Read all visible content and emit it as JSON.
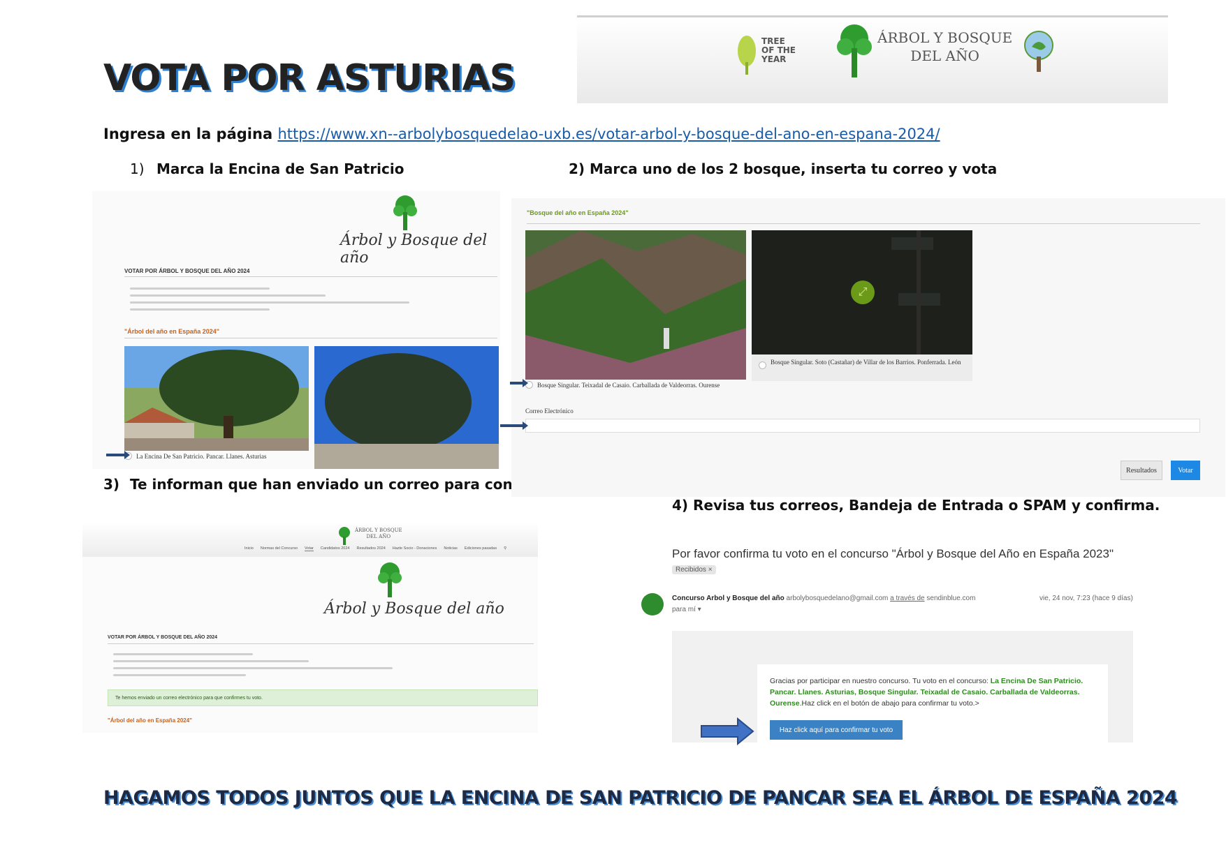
{
  "title": "VOTA POR ASTURIAS",
  "banner": {
    "tree_of_year": [
      "TREE",
      "OF THE",
      "YEAR"
    ],
    "arbol_line1": "ÁRBOL Y BOSQUE",
    "arbol_line2": "DEL AÑO"
  },
  "intro": {
    "text": "Ingresa en la página",
    "url": "https://www.xn--arbolybosquedelao-uxb.es/votar-arbol-y-bosque-del-ano-en-espana-2024/"
  },
  "steps": {
    "s1_num": "1)",
    "s1": "Marca la Encina de San Patricio",
    "s2": "2) Marca uno de los 2 bosque,  inserta tu correo y vota",
    "s3_num": "3)",
    "s3": "Te informan que han enviado un correo para confirmar.",
    "s4": "4) Revisa tus correos,  Bandeja de Entrada o SPAM y confirma."
  },
  "panel1": {
    "logo_text": "Árbol y Bosque del año",
    "heading": "VOTAR POR ÁRBOL Y BOSQUE DEL AÑO 2024",
    "section": "\"Árbol del año en España 2024\"",
    "option1": "La Encina De San Patricio. Pancar. Llanes. Asturias"
  },
  "panel2": {
    "section": "\"Bosque del año en España 2024\"",
    "option1": "Bosque Singular. Teixadal de Casaio. Carballada de Valdeorras. Ourense",
    "option2": "Bosque Singular. Soto (Castañar) de Villar de los Barrios. Ponferrada. León",
    "email_label": "Correo Electrónico",
    "results_btn": "Resultados",
    "vote_btn": "Votar"
  },
  "panel3": {
    "nav": [
      "Inicio",
      "Normas del Concurso",
      "Votar",
      "Candidatos 2024",
      "Resultados 2024",
      "Hazte Socio - Donaciones",
      "Noticias",
      "Ediciones pasadas"
    ],
    "logo_text": "Árbol y Bosque del año",
    "heading": "VOTAR POR ÁRBOL Y BOSQUE DEL AÑO 2024",
    "notice": "Te hemos enviado un correo electrónico para que confirmes tu voto.",
    "section": "\"Árbol del año en España 2024\""
  },
  "email": {
    "subject": "Por favor confirma tu voto en el concurso \"Árbol y Bosque del Año en España 2023\"",
    "chip": "Recibidos ×",
    "sender": "Concurso Arbol y Bosque del año",
    "sender_email": "arbolybosquedelano@gmail.com",
    "via": "a través de",
    "via_domain": "sendinblue.com",
    "to": "para mí ▾",
    "date": "vie, 24 nov, 7:23 (hace 9 días)",
    "body_start": "Gracias por participar en nuestro concurso.   Tu voto en el concurso:",
    "body_green": "La Encina De San Patricio. Pancar. Llanes. Asturias, Bosque Singular. Teixadal de Casaio. Carballada de Valdeorras. Ourense",
    "body_end": ".Haz click en el botón de abajo para confirmar tu voto.>",
    "confirm_btn": "Haz click aquí para confirmar tu voto"
  },
  "footer": "HAGAMOS TODOS JUNTOS QUE LA ENCINA DE SAN PATRICIO DE PANCAR SEA EL ÁRBOL DE ESPAÑA 2024",
  "colors": {
    "shadow_blue": "#2f7fd0",
    "link_blue": "#1a5ba8",
    "green": "#6a9a18",
    "vote_blue": "#1e88e5"
  }
}
